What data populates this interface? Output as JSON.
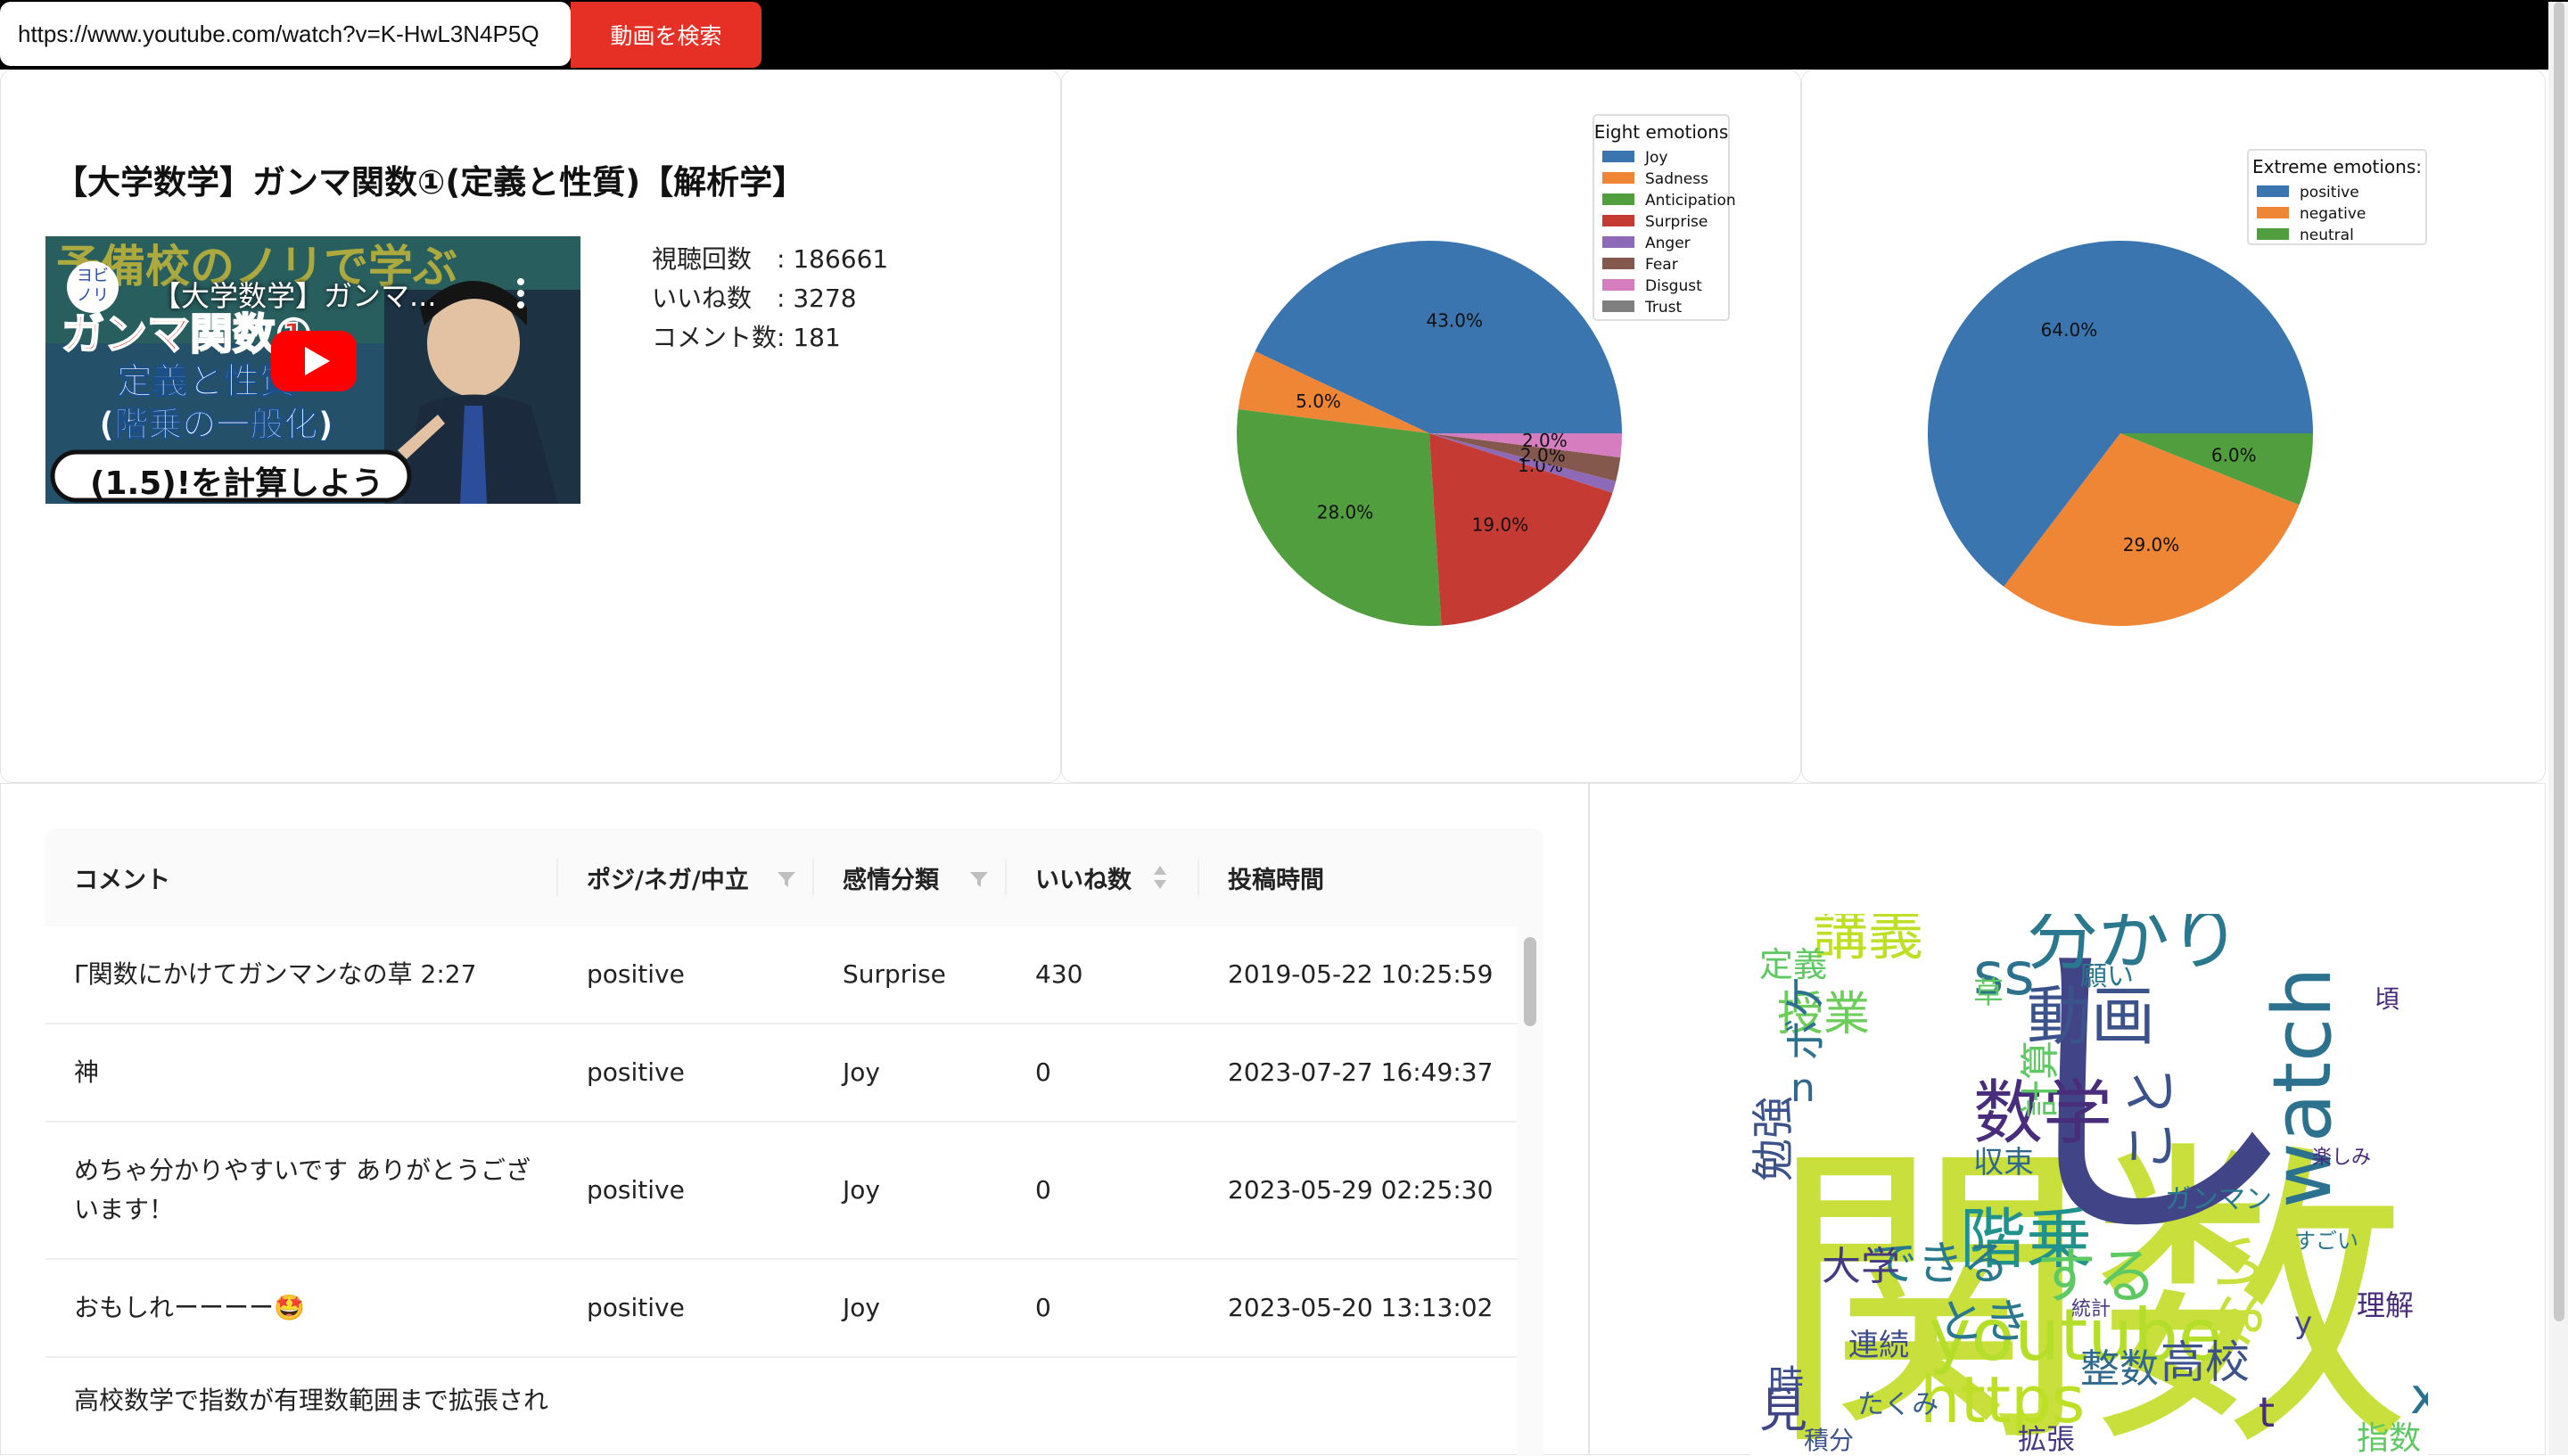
{
  "search": {
    "url_value": "https://www.youtube.com/watch?v=K-HwL3N4P5Q",
    "button_label": "動画を検索"
  },
  "video": {
    "title": "【大学数学】ガンマ関数①(定義と性質)【解析学】",
    "thumbnail": {
      "channel_badge": "ヨビノリ",
      "overlay_title": "【大学数学】ガンマ...",
      "banner_top": "予備校のノリで学ぶ",
      "banner_main": "ガンマ関数①",
      "banner_sub1": "定義と性質",
      "banner_sub2": "(階乗の一般化)",
      "banner_bottom": "(1.5)!を計算しよう",
      "play_icon": "youtube-play-icon",
      "menu_icon": "more-vert-icon"
    },
    "stats": {
      "views_label": "視聴回数　: 186661",
      "likes_label": "いいね数　: 3278",
      "comments_label": "コメント数: 181"
    }
  },
  "chart_data": [
    {
      "type": "pie",
      "legend_title": "Eight emotions",
      "legend_placement": "top-right",
      "slices": [
        {
          "name": "Joy",
          "value": 43.0,
          "label": "43.0%",
          "color": "#3a75af"
        },
        {
          "name": "Sadness",
          "value": 5.0,
          "label": "5.0%",
          "color": "#ef8636"
        },
        {
          "name": "Anticipation",
          "value": 28.0,
          "label": "28.0%",
          "color": "#519e3e"
        },
        {
          "name": "Surprise",
          "value": 19.0,
          "label": "19.0%",
          "color": "#c53a32"
        },
        {
          "name": "Anger",
          "value": 1.0,
          "label": "1.0%",
          "color": "#8d69b8"
        },
        {
          "name": "Fear",
          "value": 2.0,
          "label": "2.0%",
          "color": "#84584d"
        },
        {
          "name": "Disgust",
          "value": 2.0,
          "label": "2.0%",
          "color": "#d57dbe"
        },
        {
          "name": "Trust",
          "value": 0.0,
          "label": "",
          "color": "#7f7f7f"
        }
      ]
    },
    {
      "type": "pie",
      "legend_title": "Extreme emotions:",
      "legend_placement": "top-right",
      "slices": [
        {
          "name": "positive",
          "value": 64.0,
          "label": "64.0%",
          "color": "#3a75af"
        },
        {
          "name": "negative",
          "value": 29.0,
          "label": "29.0%",
          "color": "#ef8636"
        },
        {
          "name": "neutral",
          "value": 6.0,
          "label": "6.0%",
          "color": "#519e3e"
        }
      ]
    }
  ],
  "table": {
    "columns": [
      "コメント",
      "ポジ/ネガ/中立",
      "感情分類",
      "いいね数",
      "投稿時間"
    ],
    "filter_icon": "filter-icon",
    "sort_icon": "sort-icon",
    "rows": [
      {
        "comment": "Γ関数にかけてガンマンなの草 2:27",
        "polarity": "positive",
        "emotion": "Surprise",
        "likes": "430",
        "time": "2019-05-22 10:25:59"
      },
      {
        "comment": "神",
        "polarity": "positive",
        "emotion": "Joy",
        "likes": "0",
        "time": "2023-07-27 16:49:37"
      },
      {
        "comment": "めちゃ分かりやすいです ありがとうございます！",
        "polarity": "positive",
        "emotion": "Joy",
        "likes": "0",
        "time": "2023-05-29 02:25:30"
      },
      {
        "comment": "おもしれーーーー🤩",
        "polarity": "positive",
        "emotion": "Joy",
        "likes": "0",
        "time": "2023-05-20 13:13:02"
      },
      {
        "comment": "高校数学で指数が有理数範囲まで拡張され",
        "polarity": "",
        "emotion": "",
        "likes": "",
        "time": ""
      }
    ]
  },
  "wordcloud": {
    "words": [
      {
        "text": "関数",
        "color": "#c8df3c"
      },
      {
        "text": "し",
        "color": "#414487"
      },
      {
        "text": "分かり",
        "color": "#2a788e"
      },
      {
        "text": "動画",
        "color": "#3b528b"
      },
      {
        "text": "講義",
        "color": "#bddf26"
      },
      {
        "text": "数学",
        "color": "#472d7b"
      },
      {
        "text": "階乗",
        "color": "#21918c"
      },
      {
        "text": "watch",
        "color": "#2c728e"
      },
      {
        "text": "youtube",
        "color": "#b5de2b"
      },
      {
        "text": "https",
        "color": "#bddf26"
      },
      {
        "text": "する",
        "color": "#5ec962"
      },
      {
        "text": "高校",
        "color": "#3b528b"
      },
      {
        "text": "できる",
        "color": "#2a788e"
      },
      {
        "text": "大学",
        "color": "#443983"
      },
      {
        "text": "整数",
        "color": "#31688e"
      },
      {
        "text": "ない",
        "color": "#c8df3c"
      },
      {
        "text": "授業",
        "color": "#6ccd5a"
      },
      {
        "text": "定義",
        "color": "#5ec962"
      },
      {
        "text": "ss",
        "color": "#2c728e"
      },
      {
        "text": "こと",
        "color": "#3b528b"
      },
      {
        "text": "とき",
        "color": "#2a788e"
      },
      {
        "text": "勉強",
        "color": "#3b528b"
      },
      {
        "text": "ボケ",
        "color": "#2c728e"
      },
      {
        "text": "計算",
        "color": "#5ec962"
      },
      {
        "text": "収束",
        "color": "#31688e"
      },
      {
        "text": "見",
        "color": "#414487"
      },
      {
        "text": "連続",
        "color": "#3e4c8a"
      },
      {
        "text": "ガンマン",
        "color": "#2a788e"
      },
      {
        "text": "理解",
        "color": "#472d7b"
      },
      {
        "text": "指数",
        "color": "#5ec962"
      },
      {
        "text": "拡張",
        "color": "#443983"
      },
      {
        "text": "積分",
        "color": "#3b528b"
      },
      {
        "text": "たくみ",
        "color": "#355f8d"
      },
      {
        "text": "すごい",
        "color": "#2a788e"
      },
      {
        "text": "楽しみ",
        "color": "#482878"
      },
      {
        "text": "時",
        "color": "#3e4c8a"
      },
      {
        "text": "草",
        "color": "#5ec962"
      },
      {
        "text": "願い",
        "color": "#2a788e"
      },
      {
        "text": "統計",
        "color": "#443983"
      },
      {
        "text": "頃",
        "color": "#482878"
      },
      {
        "text": "x",
        "color": "#2c728e"
      },
      {
        "text": "t",
        "color": "#472d7b"
      },
      {
        "text": "y",
        "color": "#414487"
      },
      {
        "text": "n",
        "color": "#31688e"
      }
    ]
  }
}
